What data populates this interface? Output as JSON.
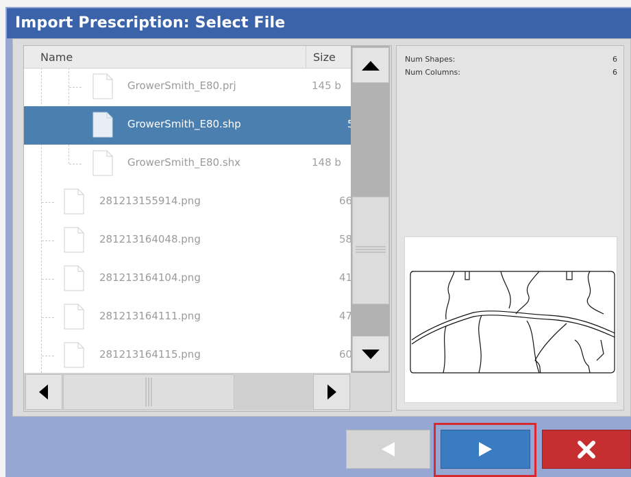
{
  "window": {
    "title": "Import Prescription: Select File"
  },
  "file_list": {
    "columns": {
      "name": "Name",
      "size": "Size"
    },
    "rows": [
      {
        "name": "GrowerSmith_E80.prj",
        "size": "145 b",
        "selected": false
      },
      {
        "name": "GrowerSmith_E80.shp",
        "size": "5",
        "selected": true
      },
      {
        "name": "GrowerSmith_E80.shx",
        "size": "148 b",
        "selected": false
      },
      {
        "name": "281213155914.png",
        "size": "66",
        "selected": false
      },
      {
        "name": "281213164048.png",
        "size": "58",
        "selected": false
      },
      {
        "name": "281213164104.png",
        "size": "41",
        "selected": false
      },
      {
        "name": "281213164111.png",
        "size": "47",
        "selected": false
      },
      {
        "name": "281213164115.png",
        "size": "60",
        "selected": false
      }
    ]
  },
  "scrollbars": {
    "up_icon": "triangle-up-icon",
    "down_icon": "triangle-down-icon",
    "left_icon": "triangle-left-icon",
    "right_icon": "triangle-right-icon"
  },
  "info": {
    "num_shapes_label": "Num Shapes:",
    "num_shapes_value": "6",
    "num_columns_label": "Num Columns:",
    "num_columns_value": "6"
  },
  "buttons": {
    "back_icon": "arrow-left-icon",
    "next_icon": "arrow-right-icon",
    "cancel_icon": "close-x-icon"
  },
  "colors": {
    "title_bar": "#3a63aa",
    "selection": "#4a7fb0",
    "next_button": "#3a7cc1",
    "cancel_button": "#c62f31",
    "highlight_outline": "#d7282f"
  }
}
